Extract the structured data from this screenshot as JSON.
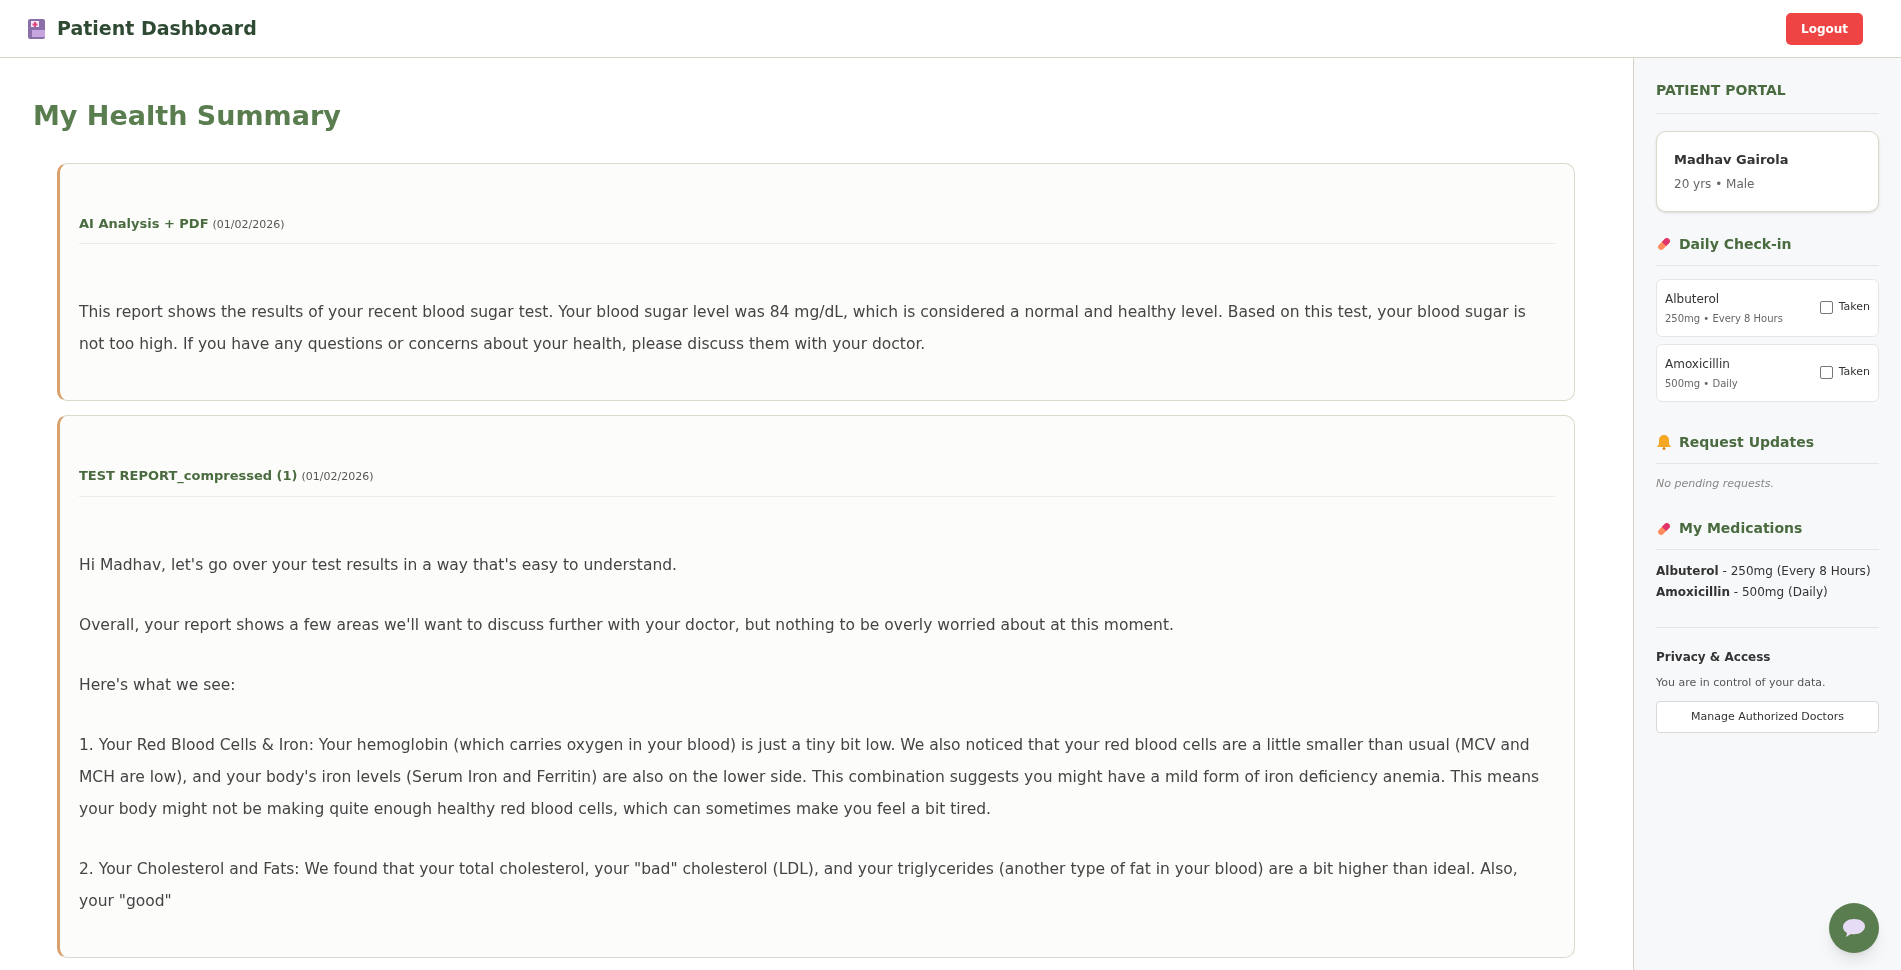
{
  "header": {
    "title": "Patient Dashboard",
    "logout": "Logout"
  },
  "main": {
    "title": "My Health Summary",
    "reports": [
      {
        "name": "AI Analysis + PDF",
        "date": "(01/02/2026)",
        "paragraphs": [
          "This report shows the results of your recent blood sugar test. Your blood sugar level was 84 mg/dL, which is considered a normal and healthy level. Based on this test, your blood sugar is not too high. If you have any questions or concerns about your health, please discuss them with your doctor."
        ]
      },
      {
        "name": "TEST REPORT_compressed (1)",
        "date": "(01/02/2026)",
        "paragraphs": [
          "Hi Madhav, let's go over your test results in a way that's easy to understand.",
          "Overall, your report shows a few areas we'll want to discuss further with your doctor, but nothing to be overly worried about at this moment.",
          "Here's what we see:",
          "1.  Your Red Blood Cells & Iron: Your hemoglobin (which carries oxygen in your blood) is just a tiny bit low. We also noticed that your red blood cells are a little smaller than usual (MCV and MCH are low), and your body's iron levels (Serum Iron and Ferritin) are also on the lower side. This combination suggests you might have a mild form of iron deficiency anemia. This means your body might not be making quite enough healthy red blood cells, which can sometimes make you feel a bit tired.",
          "2.  Your Cholesterol and Fats: We found that your total cholesterol, your \"bad\" cholesterol (LDL), and your triglycerides (another type of fat in your blood) are a bit higher than ideal. Also, your \"good\""
        ]
      }
    ]
  },
  "sidebar": {
    "portal_title": "PATIENT PORTAL",
    "profile": {
      "name": "Madhav Gairola",
      "details": "20 yrs • Male"
    },
    "checkin": {
      "title": "Daily Check-in",
      "items": [
        {
          "name": "Albuterol",
          "details": "250mg • Every 8 Hours",
          "label": "Taken",
          "checked": false
        },
        {
          "name": "Amoxicillin",
          "details": "500mg • Daily",
          "label": "Taken",
          "checked": false
        }
      ]
    },
    "requests": {
      "title": "Request Updates",
      "empty": "No pending requests."
    },
    "medications": {
      "title": "My Medications",
      "items": [
        "**Albuterol** - 250mg (Every 8 Hours)",
        "**Amoxicillin** - 500mg (Daily)"
      ]
    },
    "privacy": {
      "title": "Privacy & Access",
      "text": "You are in control of your data.",
      "button": "Manage Authorized Doctors"
    }
  }
}
